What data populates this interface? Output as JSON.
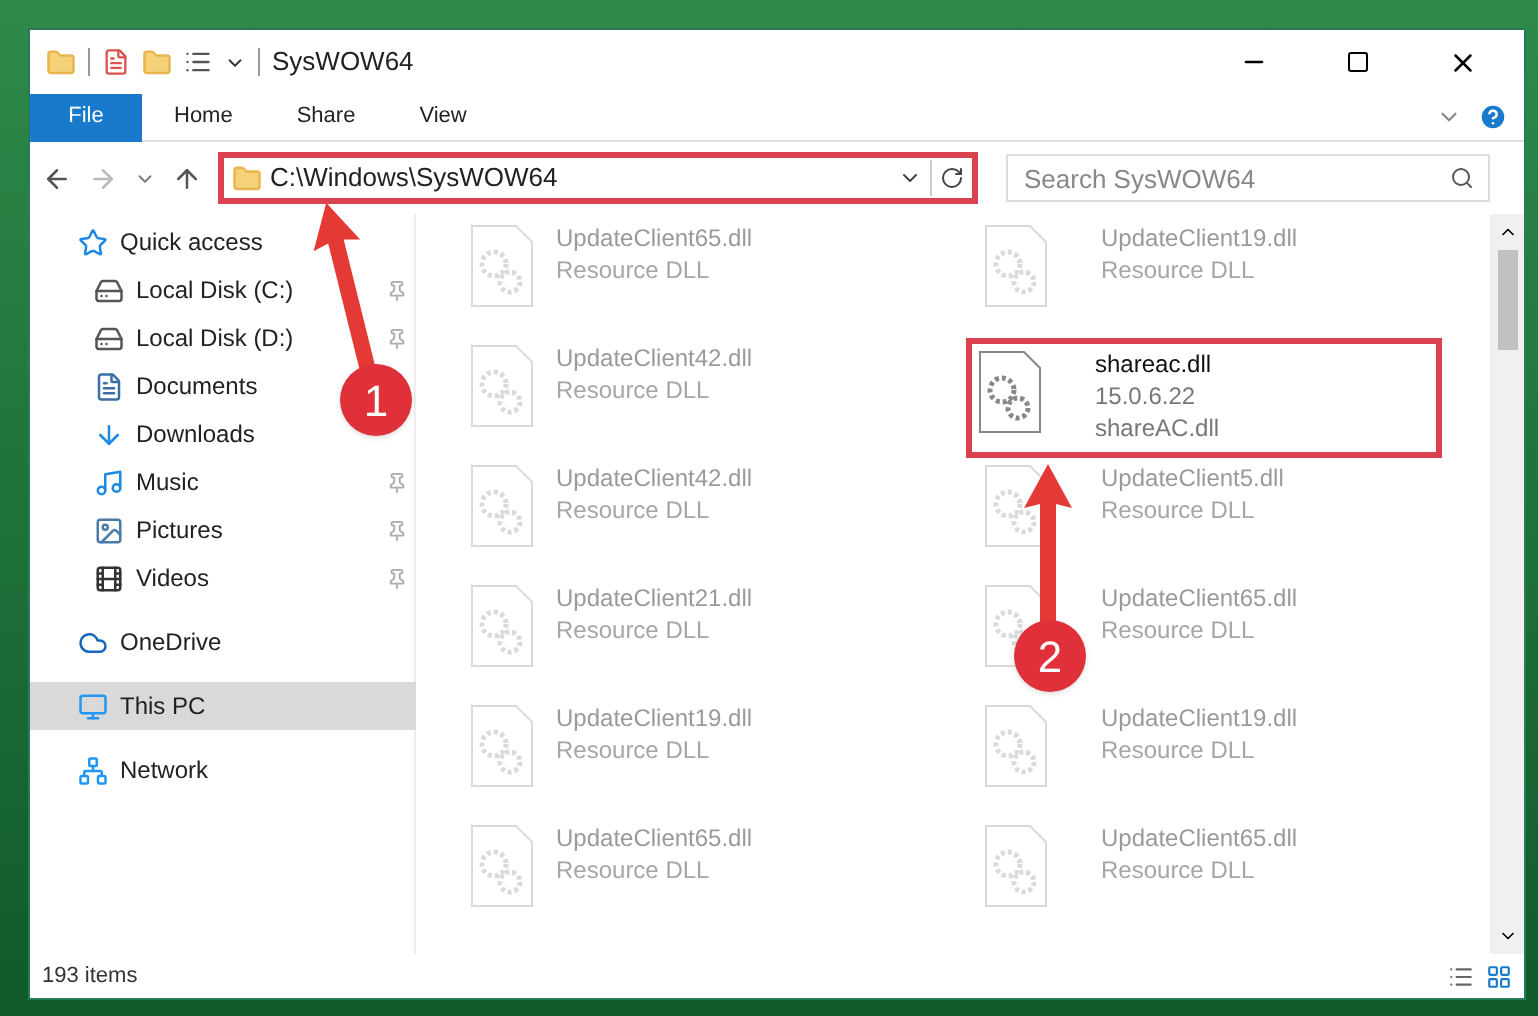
{
  "window": {
    "title": "SysWOW64"
  },
  "ribbon_tabs": [
    {
      "label": "File",
      "selected": true
    },
    {
      "label": "Home",
      "selected": false
    },
    {
      "label": "Share",
      "selected": false
    },
    {
      "label": "View",
      "selected": false
    }
  ],
  "address": {
    "path": "C:\\Windows\\SysWOW64",
    "highlighted": true
  },
  "search": {
    "placeholder": "Search SysWOW64"
  },
  "sidebar": {
    "items": [
      {
        "label": "Quick access",
        "kind": "star",
        "selected": false,
        "children": [
          {
            "label": "Local Disk (C:)",
            "kind": "disk",
            "pinned": true
          },
          {
            "label": "Local Disk (D:)",
            "kind": "disk",
            "pinned": true
          },
          {
            "label": "Documents",
            "kind": "document"
          },
          {
            "label": "Downloads",
            "kind": "download"
          },
          {
            "label": "Music",
            "kind": "music",
            "pinned": true
          },
          {
            "label": "Pictures",
            "kind": "pictures",
            "pinned": true
          },
          {
            "label": "Videos",
            "kind": "videos",
            "pinned": true
          }
        ]
      },
      {
        "label": "OneDrive",
        "kind": "cloud",
        "selected": false
      },
      {
        "label": "This PC",
        "kind": "pc",
        "selected": true
      },
      {
        "label": "Network",
        "kind": "network",
        "selected": false
      }
    ]
  },
  "files": [
    {
      "name": "UpdateClient65.dll",
      "lines": [
        "Resource DLL"
      ],
      "highlighted": false
    },
    {
      "name": "UpdateClient19.dll",
      "lines": [
        "Resource DLL"
      ],
      "highlighted": false
    },
    {
      "name": "UpdateClient42.dll",
      "lines": [
        "Resource DLL"
      ],
      "highlighted": false
    },
    {
      "name": "shareac.dll",
      "lines": [
        "15.0.6.22",
        "shareAC.dll"
      ],
      "highlighted": true
    },
    {
      "name": "UpdateClient42.dll",
      "lines": [
        "Resource DLL"
      ],
      "highlighted": false
    },
    {
      "name": "UpdateClient5.dll",
      "lines": [
        "Resource DLL"
      ],
      "highlighted": false
    },
    {
      "name": "UpdateClient21.dll",
      "lines": [
        "Resource DLL"
      ],
      "highlighted": false
    },
    {
      "name": "UpdateClient65.dll",
      "lines": [
        "Resource DLL"
      ],
      "highlighted": false
    },
    {
      "name": "UpdateClient19.dll",
      "lines": [
        "Resource DLL"
      ],
      "highlighted": false
    },
    {
      "name": "UpdateClient19.dll",
      "lines": [
        "Resource DLL"
      ],
      "highlighted": false
    },
    {
      "name": "UpdateClient65.dll",
      "lines": [
        "Resource DLL"
      ],
      "highlighted": false
    },
    {
      "name": "UpdateClient65.dll",
      "lines": [
        "Resource DLL"
      ],
      "highlighted": false
    }
  ],
  "status_bar": {
    "count": "193 items"
  },
  "callouts": [
    {
      "label": "1"
    },
    {
      "label": "2"
    }
  ]
}
